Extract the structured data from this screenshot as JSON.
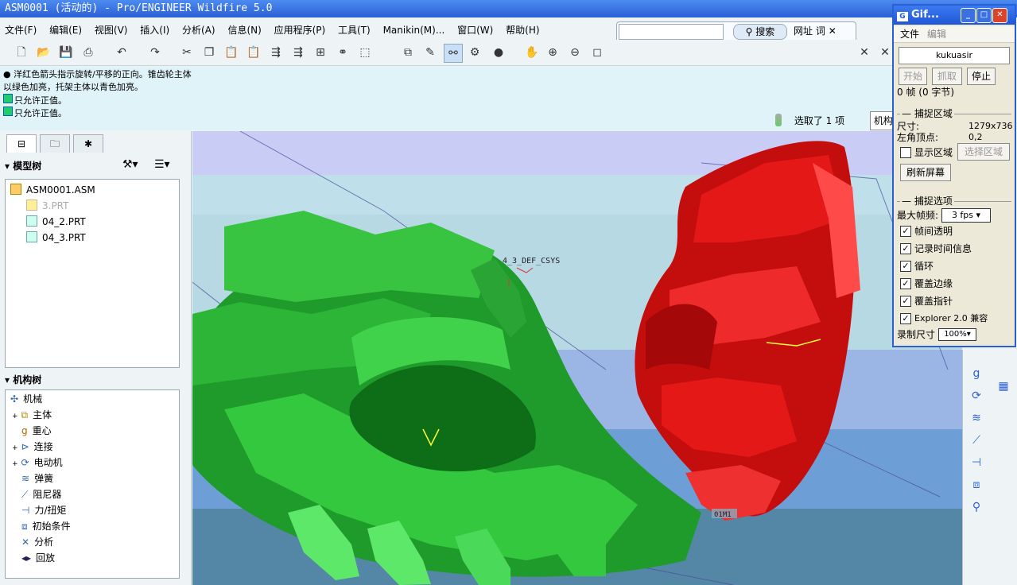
{
  "window": {
    "title": "ASM0001 (活动的) - Pro/ENGINEER Wildfire 5.0"
  },
  "menu": [
    "文件(F)",
    "编辑(E)",
    "视图(V)",
    "插入(I)",
    "分析(A)",
    "信息(N)",
    "应用程序(P)",
    "工具(T)",
    "Manikin(M)...",
    "窗口(W)",
    "帮助(H)"
  ],
  "search": {
    "search_label": "搜索",
    "web_label": "网址",
    "dict_label": "词"
  },
  "messages": [
    "● 洋红色箭头指示旋转/平移的正向。锥齿轮主体",
    "以绿色加亮，托架主体以青色加亮。",
    "只允许正值。",
    "只允许正值。"
  ],
  "status": {
    "selection": "选取了 1 项",
    "filter": "机构"
  },
  "model_tree": {
    "title": "模型树",
    "items": [
      "ASM0001.ASM",
      "3.PRT",
      "04_2.PRT",
      "04_3.PRT"
    ]
  },
  "mech_tree": {
    "title": "机构树",
    "root": "机械",
    "items": [
      "主体",
      "重心",
      "连接",
      "电动机",
      "弹簧",
      "阻尼器",
      "力/扭矩",
      "初始条件",
      "分析",
      "回放"
    ]
  },
  "viewport": {
    "csys_label": "4_3_DEF_CSYS",
    "tag_label": "01M1"
  },
  "gif_window": {
    "title": "Gif...",
    "menu": [
      "文件",
      "编辑"
    ],
    "user": "kukuasir",
    "buttons": {
      "start": "开始",
      "capture": "抓取",
      "stop": "停止"
    },
    "frames": "0 帧 (0 字节)",
    "capture_area": {
      "title": "捕捉区域",
      "size_label": "尺寸:",
      "size_value": "1279x736",
      "corner_label": "左角顶点:",
      "corner_value": "0,2",
      "show_area": "显示区域",
      "select_area": "选择区域",
      "refresh": "刷新屏幕"
    },
    "capture_options": {
      "title": "捕捉选项",
      "max_fps_label": "最大帧频:",
      "max_fps_value": "3 fps",
      "checks": [
        "帧间透明",
        "记录时间信息",
        "循环",
        "覆盖边缘",
        "覆盖指针",
        "Explorer 2.0 兼容"
      ],
      "record_size_label": "录制尺寸",
      "record_size_value": "100%"
    }
  },
  "colors": {
    "title_bar": "#2a5fd6",
    "gear_green": "#2fbf3a",
    "gear_red": "#e01010",
    "message_bg": "#dff3f8"
  }
}
